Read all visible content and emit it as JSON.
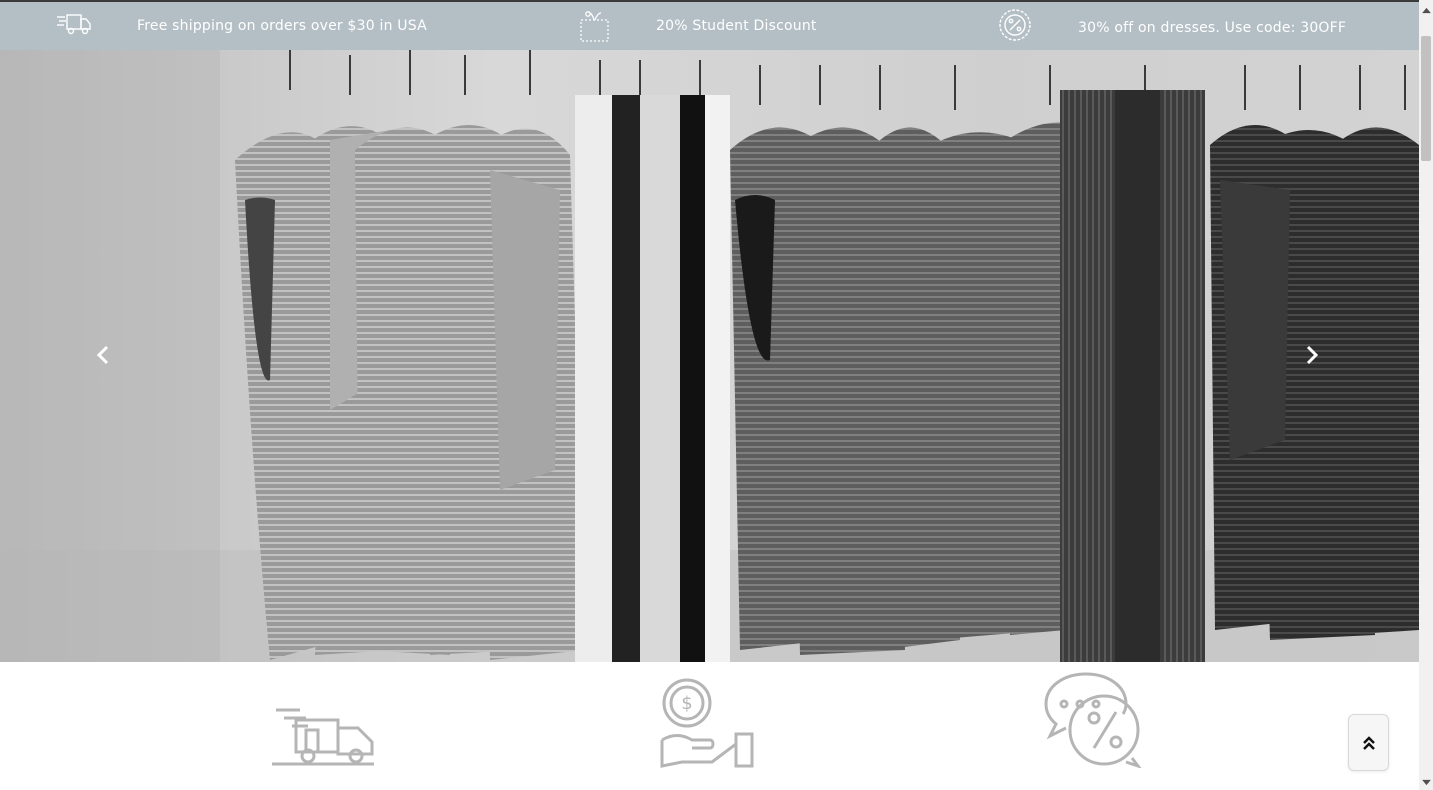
{
  "topbar": {
    "promos": [
      {
        "icon": "delivery-truck-icon",
        "text": "Free shipping on orders over $30 in USA"
      },
      {
        "icon": "gift-coupon-icon",
        "text": "20% Student Discount"
      },
      {
        "icon": "percent-badge-icon",
        "text": "30% off on dresses. Use code: 30OFF"
      }
    ],
    "background": "#b3bfc5",
    "text_color": "#ffffff"
  },
  "hero": {
    "image": "clothing-rack-photo",
    "prev_icon": "chevron-left-icon",
    "next_icon": "chevron-right-icon"
  },
  "features": [
    {
      "icon": "fast-delivery-truck-icon"
    },
    {
      "icon": "money-hand-icon"
    },
    {
      "icon": "chat-discount-icon"
    }
  ],
  "back_to_top": {
    "icon": "double-chevron-up-icon"
  },
  "colors": {
    "feature_icon": "#b5b5b5",
    "accent": "#b3bfc5"
  }
}
